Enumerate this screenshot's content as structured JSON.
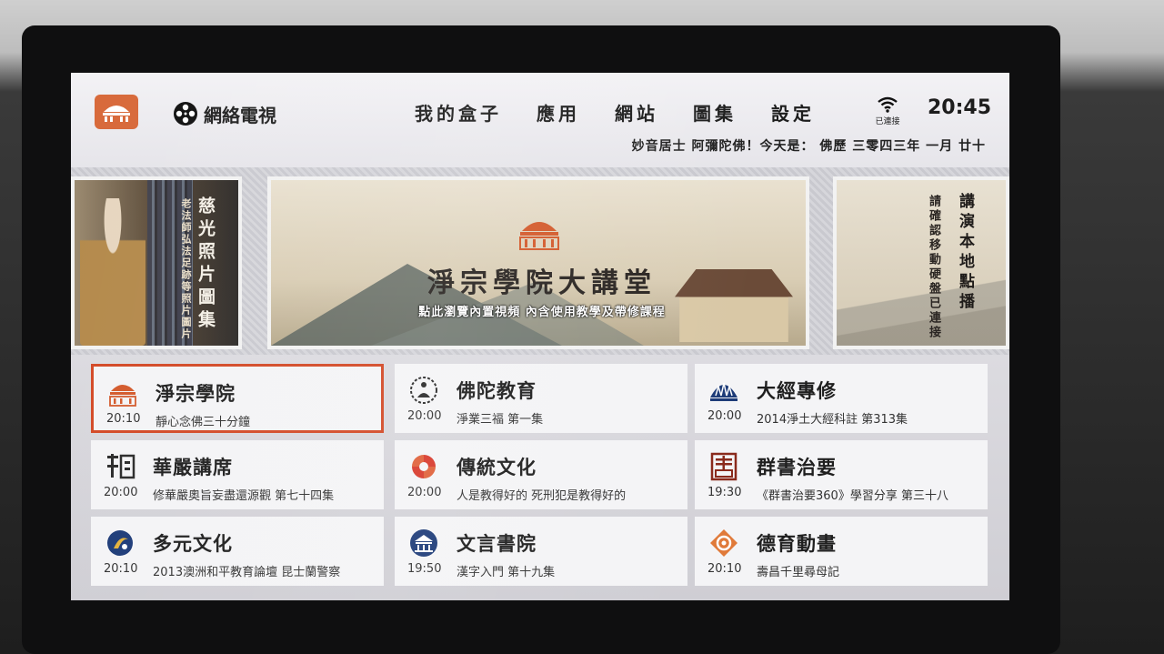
{
  "header": {
    "logo_icon": "amtb-logo-icon",
    "iptv_label": "網絡電視",
    "nav": [
      "我的盒子",
      "應用",
      "網站",
      "圖集",
      "設定"
    ],
    "wifi_label": "已連接",
    "clock": "20:45",
    "greeting": "妙音居士 阿彌陀佛！今天是： 佛歷 三零四三年 一月 廿十"
  },
  "banners": {
    "left": {
      "title": "慈光照片圖集",
      "subtitle": "老法師弘法足跡等照片圖片"
    },
    "center": {
      "title": "淨宗學院大講堂",
      "subtitle": "點此瀏覽內置視頻 內含使用教學及帶修課程"
    },
    "right": {
      "title": "講演本地點播",
      "subtitle": "請確認移動硬盤已連接"
    }
  },
  "tiles": [
    {
      "title": "淨宗學院",
      "time": "20:10",
      "program": "靜心念佛三十分鐘",
      "icon": "amtb-icon"
    },
    {
      "title": "佛陀教育",
      "time": "20:00",
      "program": "淨業三福 第一集",
      "icon": "meditation-icon"
    },
    {
      "title": "大經專修",
      "time": "20:00",
      "program": "2014淨土大經科註 第313集",
      "icon": "lotus-icon"
    },
    {
      "title": "華嚴講席",
      "time": "20:00",
      "program": "修華嚴奧旨妄盡還源觀 第七十四集",
      "icon": "huayan-icon"
    },
    {
      "title": "傳統文化",
      "time": "20:00",
      "program": "人是教得好的 死刑犯是教得好的",
      "icon": "swirl-icon"
    },
    {
      "title": "群書治要",
      "time": "19:30",
      "program": "《群書治要360》學習分享 第三十八",
      "icon": "book-icon"
    },
    {
      "title": "多元文化",
      "time": "20:10",
      "program": "2013澳洲和平教育論壇 昆士蘭警察",
      "icon": "globe-icon"
    },
    {
      "title": "文言書院",
      "time": "19:50",
      "program": "漢字入門 第十九集",
      "icon": "temple-icon"
    },
    {
      "title": "德育動畫",
      "time": "20:10",
      "program": "壽昌千里尋母記",
      "icon": "diamond-icon"
    }
  ],
  "colors": {
    "accent": "#d34a27",
    "brand": "#d8693a",
    "navy": "#1d3b78"
  }
}
